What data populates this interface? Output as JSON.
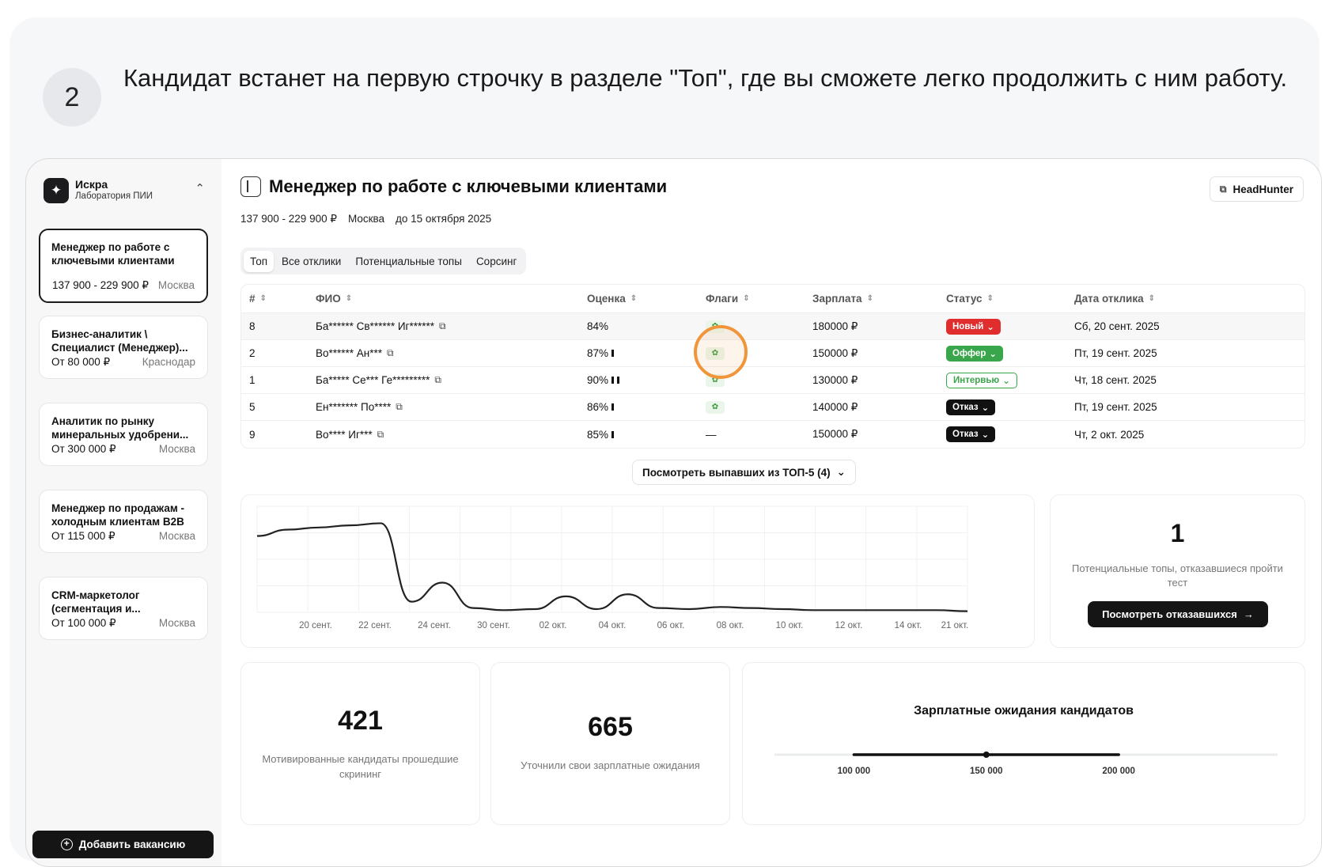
{
  "step": {
    "number": "2",
    "text": "Кандидат встанет на первую строчку в разделе \"Топ\", где вы сможете легко продолжить с ним работу."
  },
  "org": {
    "name": "Искра",
    "subtitle": "Лаборатория ПИИ",
    "logo_icon": "sparkle-icon"
  },
  "vacancies": [
    {
      "title": "Менеджер по работе с ключевыми клиентами",
      "salary": "137 900 - 229 900 ₽",
      "city": "Москва",
      "active": true
    },
    {
      "title": "Бизнес-аналитик \\ Специалист (Менеджер)...",
      "salary": "От 80 000 ₽",
      "city": "Краснодар"
    },
    {
      "title": "Аналитик по рынку минеральных удобрени...",
      "salary": "От 300 000 ₽",
      "city": "Москва"
    },
    {
      "title": "Менеджер по продажам - холодным клиентам B2B",
      "salary": "От 115 000 ₽",
      "city": "Москва"
    },
    {
      "title": "CRM-маркетолог (сегментация и...",
      "salary": "От 100 000 ₽",
      "city": "Москва"
    }
  ],
  "add_vacancy_label": "Добавить вакансию",
  "header": {
    "title": "Менеджер по работе с ключевыми клиентами",
    "hh_label": "HeadHunter",
    "salary": "137 900 - 229 900 ₽",
    "city": "Москва",
    "deadline": "до 15 октября 2025"
  },
  "tabs": [
    "Топ",
    "Все отклики",
    "Потенциальные топы",
    "Сорсинг"
  ],
  "table": {
    "columns": [
      "#",
      "ФИО",
      "Оценка",
      "Флаги",
      "Зарплата",
      "Статус",
      "Дата отклика"
    ],
    "rows": [
      {
        "num": "8",
        "name": "Ба****** Св****** Иг******",
        "score": "84%",
        "bars": 0,
        "flag": true,
        "salary": "180000 ₽",
        "status": "Новый",
        "status_type": "new",
        "date": "Сб, 20 сент. 2025"
      },
      {
        "num": "2",
        "name": "Во****** Ан***",
        "score": "87%",
        "bars": 1,
        "flag": true,
        "salary": "150000 ₽",
        "status": "Оффер",
        "status_type": "offer",
        "date": "Пт, 19 сент. 2025"
      },
      {
        "num": "1",
        "name": "Ба***** Се*** Ге*********",
        "score": "90%",
        "bars": 2,
        "flag": true,
        "salary": "130000 ₽",
        "status": "Интервью",
        "status_type": "interview",
        "date": "Чт, 18 сент. 2025"
      },
      {
        "num": "5",
        "name": "Ен******* По****",
        "score": "86%",
        "bars": 1,
        "flag": true,
        "salary": "140000 ₽",
        "status": "Отказ",
        "status_type": "reject",
        "date": "Пт, 19 сент. 2025"
      },
      {
        "num": "9",
        "name": "Во**** Иг***",
        "score": "85%",
        "bars": 1,
        "flag": false,
        "flag_text": "—",
        "salary": "150000 ₽",
        "status": "Отказ",
        "status_type": "reject",
        "date": "Чт, 2 окт. 2025"
      }
    ]
  },
  "more_button_label": "Посмотреть выпавших из ТОП-5 (4)",
  "chart_data": {
    "type": "line",
    "title": "",
    "xlabel": "",
    "ylabel": "",
    "grid": true,
    "x_ticks": [
      "20 сент.",
      "22 сент.",
      "24 сент.",
      "30 сент.",
      "02 окт.",
      "04 окт.",
      "06 окт.",
      "08 окт.",
      "10 окт.",
      "12 окт.",
      "14 окт.",
      "21 окт."
    ],
    "series": [
      {
        "values": [
          72,
          78,
          80,
          82,
          84,
          10,
          28,
          4,
          2,
          3,
          15,
          3,
          17,
          4,
          3,
          5,
          4,
          3,
          2,
          2,
          2,
          2,
          2,
          1
        ]
      }
    ],
    "ylim": [
      0,
      100
    ]
  },
  "refused": {
    "value": "1",
    "label": "Потенциальные топы, отказавшиеся пройти тест",
    "button_label": "Посмотреть отказавшихся"
  },
  "stats": {
    "motivated": {
      "value": "421",
      "label": "Мотивированные кандидаты прошедшие скрининг"
    },
    "clarified": {
      "value": "665",
      "label": "Уточнили свои зарплатные ожидания"
    }
  },
  "salary_expectations": {
    "title": "Зарплатные ожидания кандидатов",
    "min": 100000,
    "median": 150000,
    "max": 200000,
    "tick_labels": [
      "100 000",
      "150 000",
      "200 000"
    ]
  },
  "colors": {
    "new": "#e02d2d",
    "offer": "#3aa64b",
    "reject": "#111111",
    "highlight": "#f0953a"
  }
}
